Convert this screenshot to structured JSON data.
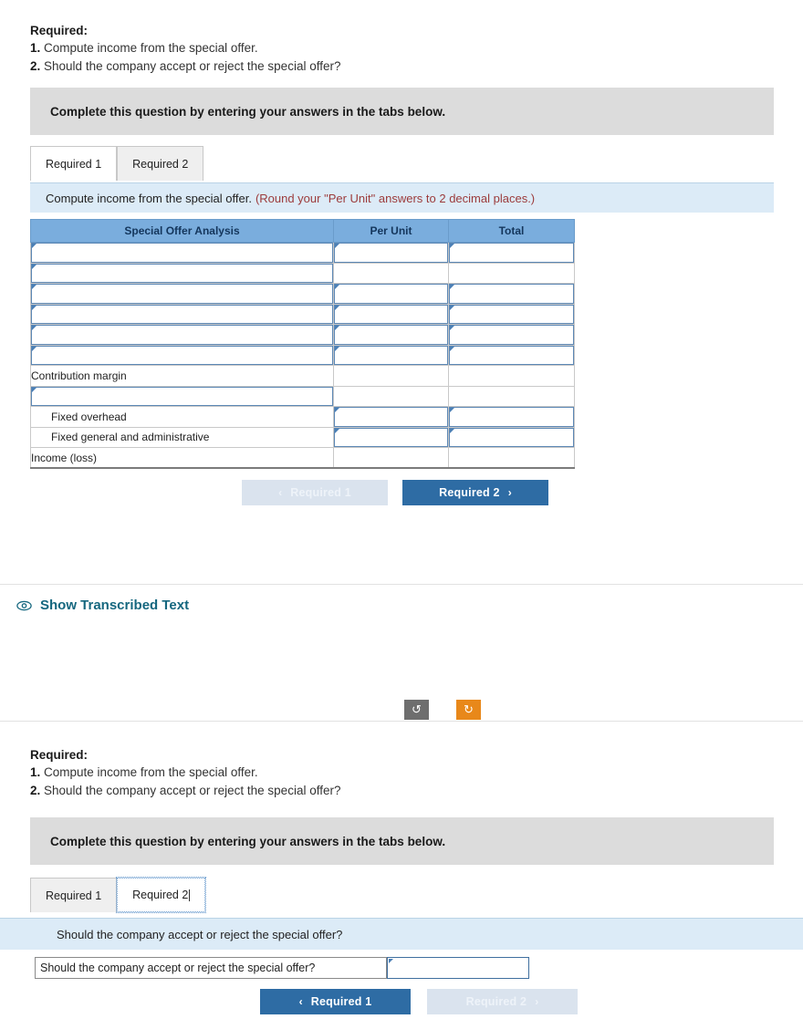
{
  "top_section": {
    "required_heading": "Required:",
    "items": [
      {
        "num": "1.",
        "text": "Compute income from the special offer."
      },
      {
        "num": "2.",
        "text": "Should the company accept or reject the special offer?"
      }
    ],
    "instruction_banner": "Complete this question by entering your answers in the tabs below.",
    "tabs": [
      {
        "label": "Required 1",
        "state": "active"
      },
      {
        "label": "Required 2",
        "state": "inactive"
      }
    ],
    "question_banner": {
      "text": "Compute income from the special offer.",
      "hint": "(Round your \"Per Unit\" answers to 2 decimal places.)"
    },
    "table": {
      "headers": [
        "Special Offer Analysis",
        "Per Unit",
        "Total"
      ],
      "rows": [
        {
          "label": "",
          "label_input": true,
          "indent": false,
          "per_unit_input": true,
          "total_input": true
        },
        {
          "label": "",
          "label_input": true,
          "indent": false,
          "per_unit_input": false,
          "total_input": false
        },
        {
          "label": "",
          "label_input": true,
          "indent": false,
          "per_unit_input": true,
          "total_input": true
        },
        {
          "label": "",
          "label_input": true,
          "indent": false,
          "per_unit_input": true,
          "total_input": true
        },
        {
          "label": "",
          "label_input": true,
          "indent": false,
          "per_unit_input": true,
          "total_input": true
        },
        {
          "label": "",
          "label_input": true,
          "indent": false,
          "per_unit_input": true,
          "total_input": true
        },
        {
          "label": "Contribution margin",
          "label_input": false,
          "indent": false,
          "per_unit_input": false,
          "total_input": false
        },
        {
          "label": "",
          "label_input": true,
          "indent": false,
          "per_unit_input": false,
          "total_input": false
        },
        {
          "label": "Fixed overhead",
          "label_input": false,
          "indent": true,
          "per_unit_input": true,
          "total_input": true
        },
        {
          "label": "Fixed general and administrative",
          "label_input": false,
          "indent": true,
          "per_unit_input": true,
          "total_input": true
        },
        {
          "label": "Income (loss)",
          "label_input": false,
          "indent": false,
          "per_unit_input": false,
          "total_input": false
        }
      ]
    },
    "nav": {
      "prev": {
        "label": "Required 1",
        "chevron": "‹",
        "state": "disabled"
      },
      "next": {
        "label": "Required 2",
        "chevron": "›",
        "state": "enabled"
      }
    }
  },
  "transcribe": {
    "label": "Show Transcribed Text",
    "icon": "eye-icon"
  },
  "actions": {
    "undo": {
      "icon": "rotate-ccw-icon",
      "glyph": "↺",
      "color": "#6e6e6e"
    },
    "redo": {
      "icon": "rotate-cw-icon",
      "glyph": "↻",
      "color": "#e8881a"
    }
  },
  "bottom_section": {
    "required_heading": "Required:",
    "items": [
      {
        "num": "1.",
        "text": "Compute income from the special offer."
      },
      {
        "num": "2.",
        "text": "Should the company accept or reject the special offer?"
      }
    ],
    "instruction_banner": "Complete this question by entering your answers in the tabs below.",
    "tabs": [
      {
        "label": "Required 1",
        "state": "inactive"
      },
      {
        "label": "Required 2",
        "state": "focused"
      }
    ],
    "question_banner": {
      "text": "Should the company accept or reject the special offer?",
      "hint": ""
    },
    "answer_row": {
      "label": "Should the company accept or reject the special offer?",
      "value": ""
    },
    "nav": {
      "prev": {
        "label": "Required 1",
        "chevron": "‹",
        "state": "enabled"
      },
      "next": {
        "label": "Required 2",
        "chevron": "›",
        "state": "disabled"
      }
    }
  },
  "colors": {
    "table_header_blue": "#7aaddd",
    "banner_grey": "#dcdcdc",
    "banner_blue": "#dcebf7",
    "hint_red": "#9c3b3b",
    "primary_blue": "#2e6ca4",
    "muted_blue": "#dae3ee",
    "link_teal": "#15677f",
    "orange": "#e8881a",
    "grey_button": "#6e6e6e"
  }
}
